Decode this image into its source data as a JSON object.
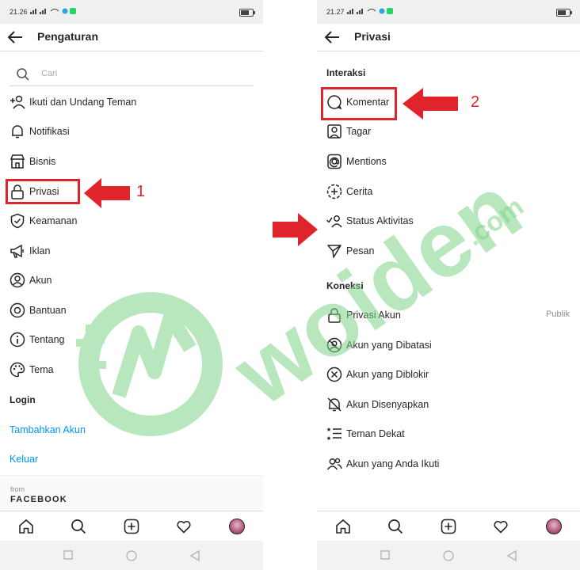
{
  "left": {
    "status_time": "21.26",
    "title": "Pengaturan",
    "search_placeholder": "Cari",
    "items": [
      {
        "label": "Ikuti dan Undang Teman",
        "icon": "add-person-icon"
      },
      {
        "label": "Notifikasi",
        "icon": "bell-icon"
      },
      {
        "label": "Bisnis",
        "icon": "shop-icon"
      },
      {
        "label": "Privasi",
        "icon": "lock-icon"
      },
      {
        "label": "Keamanan",
        "icon": "shield-icon"
      },
      {
        "label": "Iklan",
        "icon": "megaphone-icon"
      },
      {
        "label": "Akun",
        "icon": "account-icon"
      },
      {
        "label": "Bantuan",
        "icon": "help-icon"
      },
      {
        "label": "Tentang",
        "icon": "info-icon"
      },
      {
        "label": "Tema",
        "icon": "palette-icon"
      }
    ],
    "login_heading": "Login",
    "add_account": "Tambahkan Akun",
    "logout": "Keluar",
    "footer_from": "from",
    "footer_brand": "FACEBOOK",
    "annotation_number": "1"
  },
  "right": {
    "status_time": "21.27",
    "title": "Privasi",
    "section_interaksi": "Interaksi",
    "interaksi_items": [
      {
        "label": "Komentar",
        "icon": "comment-icon"
      },
      {
        "label": "Tagar",
        "icon": "tag-person-icon"
      },
      {
        "label": "Mentions",
        "icon": "at-icon"
      },
      {
        "label": "Cerita",
        "icon": "story-add-icon"
      },
      {
        "label": "Status Aktivitas",
        "icon": "activity-status-icon"
      },
      {
        "label": "Pesan",
        "icon": "send-icon"
      }
    ],
    "section_koneksi": "Koneksi",
    "koneksi_items": [
      {
        "label": "Privasi Akun",
        "icon": "lock-icon",
        "value": "Publik"
      },
      {
        "label": "Akun yang Dibatasi",
        "icon": "restricted-icon"
      },
      {
        "label": "Akun yang Diblokir",
        "icon": "blocked-icon"
      },
      {
        "label": "Akun Disenyapkan",
        "icon": "muted-bell-icon"
      },
      {
        "label": "Teman Dekat",
        "icon": "close-friends-icon"
      },
      {
        "label": "Akun yang Anda Ikuti",
        "icon": "following-icon"
      }
    ],
    "annotation_number": "2"
  },
  "watermark_text": "woiden",
  "watermark_suffix": ".com",
  "colors": {
    "accent_link": "#0095f6",
    "annotation_red": "#e0242c",
    "watermark_green": "#7fd48a"
  }
}
